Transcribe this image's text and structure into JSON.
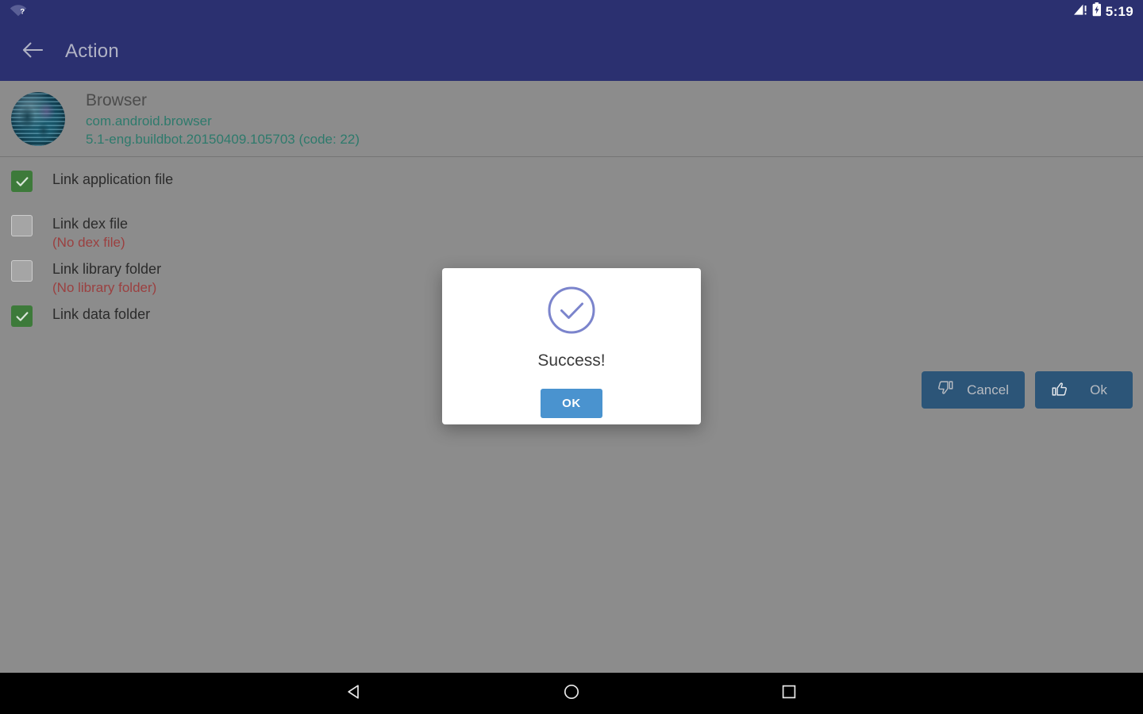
{
  "status_bar": {
    "wifi_icon": "wifi-question-icon",
    "signal_icon": "signal-warning-icon",
    "battery_icon": "battery-charging-icon",
    "time": "5:19"
  },
  "app_bar": {
    "back_icon": "arrow-left-icon",
    "title": "Action"
  },
  "app_info": {
    "icon": "browser-globe-icon",
    "name": "Browser",
    "package": "com.android.browser",
    "version": "5.1-eng.buildbot.20150409.105703 (code: 22)"
  },
  "options": [
    {
      "label": "Link application file",
      "checked": true,
      "note": ""
    },
    {
      "label": "Link dex file",
      "checked": false,
      "note": "(No dex file)"
    },
    {
      "label": "Link library folder",
      "checked": false,
      "note": "(No library folder)"
    },
    {
      "label": "Link data folder",
      "checked": true,
      "note": ""
    }
  ],
  "action_buttons": {
    "cancel": {
      "label": "Cancel",
      "icon": "thumbs-down-icon"
    },
    "ok": {
      "label": "Ok",
      "icon": "thumbs-up-icon"
    }
  },
  "dialog": {
    "icon": "check-circle-icon",
    "message": "Success!",
    "ok_label": "OK"
  },
  "nav_bar": {
    "back": "triangle-back-icon",
    "home": "circle-home-icon",
    "recents": "square-recents-icon"
  },
  "colors": {
    "app_bar": "#2b3070",
    "scrim_background": "#8c8c8c",
    "checkbox_checked": "#3d7a3a",
    "note_text": "#9b4040",
    "meta_text": "#2e7a6c",
    "dialog_accent": "#7b84cc",
    "dialog_button": "#4a93cf",
    "action_button": "#2c5578"
  }
}
